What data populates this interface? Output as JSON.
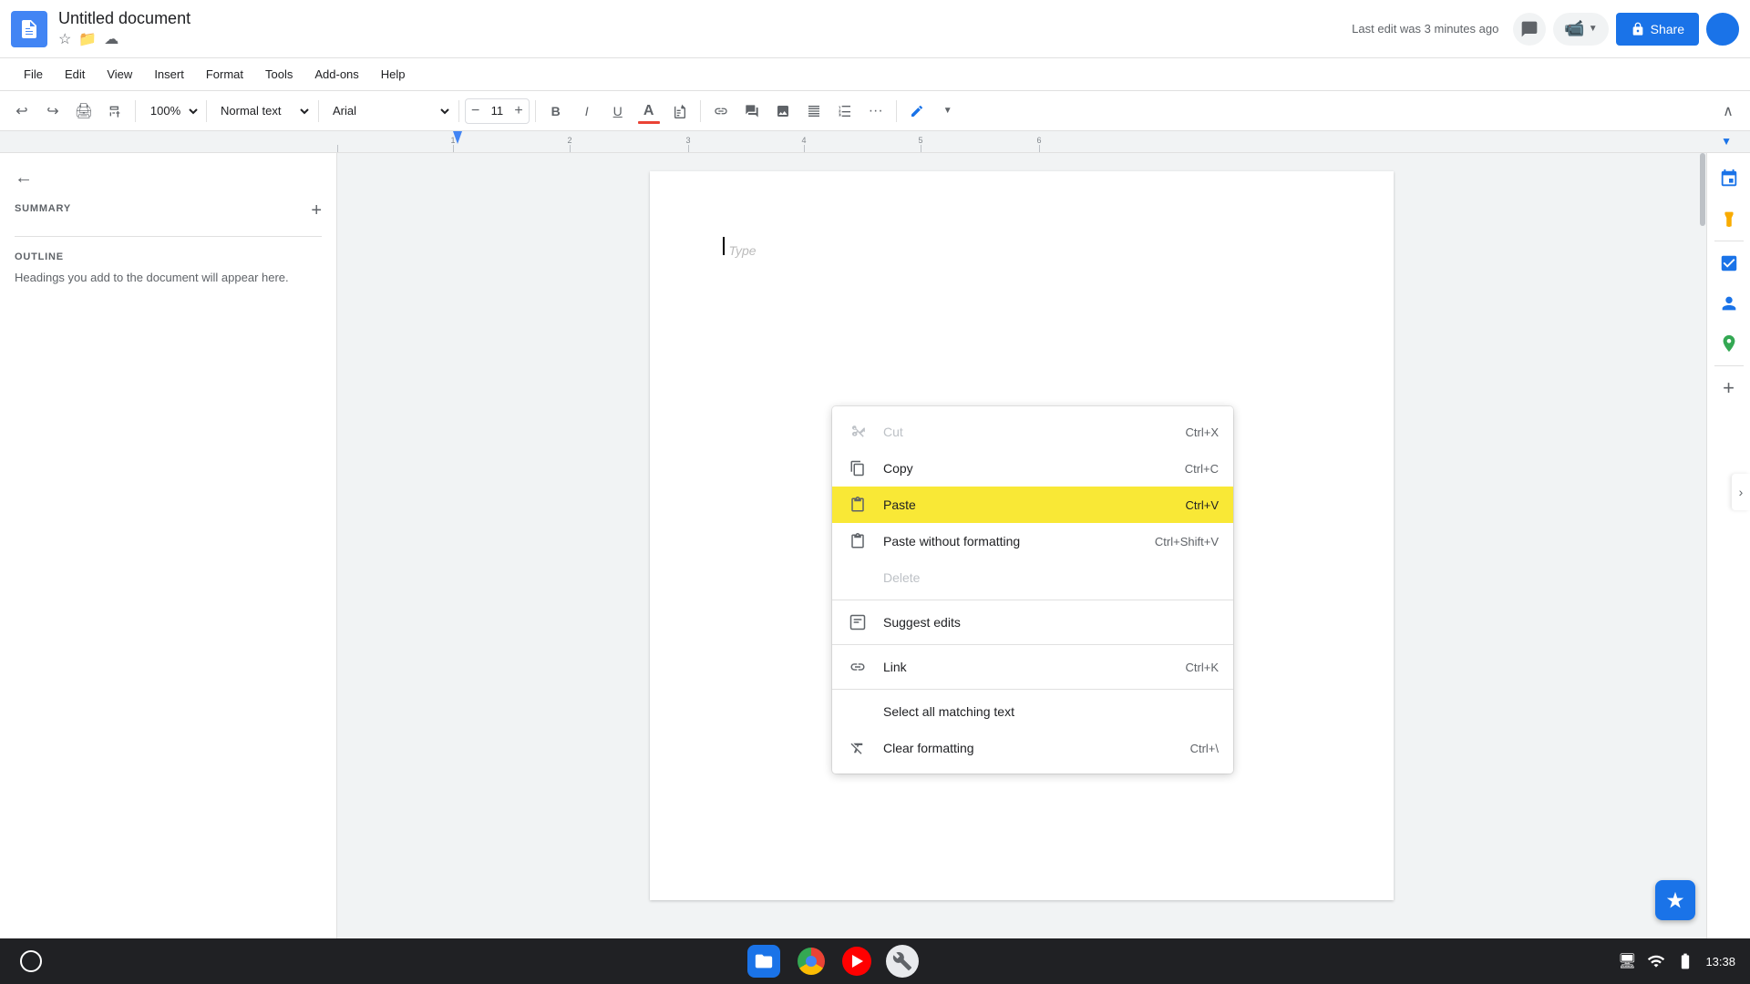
{
  "app": {
    "name": "Google Docs",
    "icon_label": "docs-icon"
  },
  "doc": {
    "title": "Untitled document",
    "last_edit": "Last edit was 3 minutes ago"
  },
  "header": {
    "share_label": "Share",
    "comments_icon": "💬",
    "meet_icon": "📹"
  },
  "menu": {
    "items": [
      "File",
      "Edit",
      "View",
      "Insert",
      "Format",
      "Tools",
      "Add-ons",
      "Help"
    ]
  },
  "toolbar": {
    "undo_label": "↩",
    "redo_label": "↪",
    "print_label": "🖨",
    "paint_format_label": "🎨",
    "zoom_value": "100%",
    "style_value": "Normal text",
    "font_value": "Arial",
    "font_size": "11",
    "bold_label": "B",
    "italic_label": "I",
    "underline_label": "U",
    "text_color_label": "A",
    "highlight_label": "🖊",
    "link_label": "🔗",
    "comment_label": "💬",
    "image_label": "🖼",
    "align_label": "≡",
    "list_label": "☰",
    "more_label": "…",
    "pen_label": "✏"
  },
  "sidebar": {
    "back_icon": "←",
    "summary_title": "SUMMARY",
    "add_icon": "+",
    "outline_title": "OUTLINE",
    "outline_text": "Headings you add to the document will appear here."
  },
  "context_menu": {
    "items": [
      {
        "icon": "✂",
        "label": "Cut",
        "shortcut": "Ctrl+X",
        "disabled": true,
        "highlighted": false
      },
      {
        "icon": "📋",
        "label": "Copy",
        "shortcut": "Ctrl+C",
        "disabled": false,
        "highlighted": false
      },
      {
        "icon": "📋",
        "label": "Paste",
        "shortcut": "Ctrl+V",
        "disabled": false,
        "highlighted": true
      },
      {
        "icon": "📋",
        "label": "Paste without formatting",
        "shortcut": "Ctrl+Shift+V",
        "disabled": false,
        "highlighted": false
      },
      {
        "icon": "",
        "label": "Delete",
        "shortcut": "",
        "disabled": true,
        "highlighted": false
      },
      {
        "icon": "🗒",
        "label": "Suggest edits",
        "shortcut": "",
        "disabled": false,
        "highlighted": false
      },
      {
        "icon": "🔗",
        "label": "Link",
        "shortcut": "Ctrl+K",
        "disabled": false,
        "highlighted": false
      },
      {
        "icon": "",
        "label": "Select all matching text",
        "shortcut": "",
        "disabled": false,
        "highlighted": false
      },
      {
        "icon": "✂",
        "label": "Clear formatting",
        "shortcut": "Ctrl+\\",
        "disabled": false,
        "highlighted": false
      }
    ]
  },
  "doc_body": {
    "placeholder": "Type"
  },
  "right_sidebar": {
    "icons": [
      {
        "name": "calendar",
        "glyph": "📅",
        "class": "calendar"
      },
      {
        "name": "keepnote",
        "glyph": "💡",
        "class": "keepnote"
      },
      {
        "name": "tasks",
        "glyph": "✔",
        "class": "tasks"
      },
      {
        "name": "contacts",
        "glyph": "👤",
        "class": "contacts"
      },
      {
        "name": "maps",
        "glyph": "📍",
        "class": "maps"
      }
    ]
  },
  "taskbar": {
    "time": "13:38",
    "wifi_icon": "wifi-icon",
    "battery_icon": "battery-icon",
    "display_icon": "display-icon"
  }
}
